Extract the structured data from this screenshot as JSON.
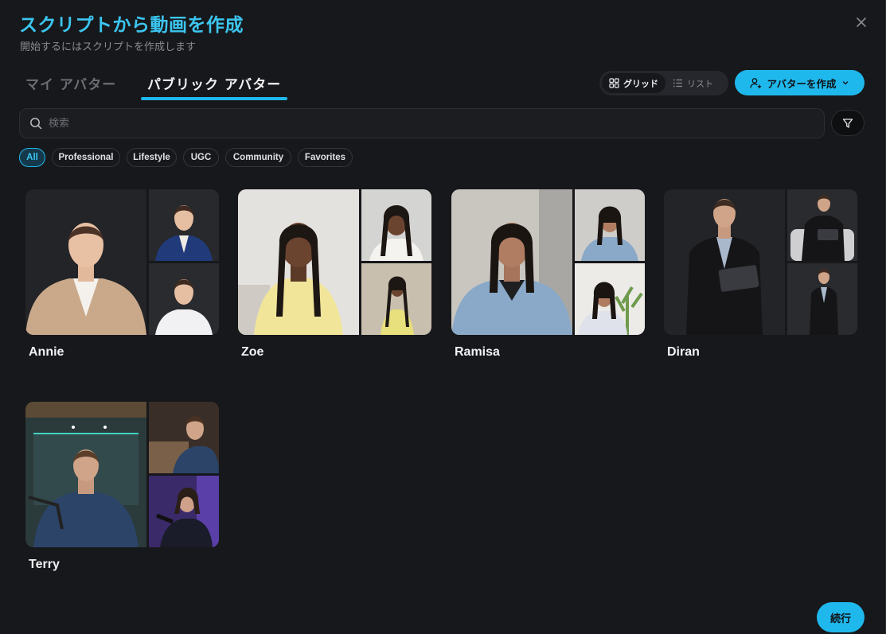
{
  "header": {
    "title": "スクリプトから動画を作成",
    "subtitle": "開始するにはスクリプトを作成します"
  },
  "tabs": [
    {
      "label": "マイ アバター",
      "active": false
    },
    {
      "label": "パブリック アバター",
      "active": true
    }
  ],
  "view_toggle": {
    "grid_label": "グリッド",
    "list_label": "リスト",
    "selected": "grid"
  },
  "create_button": {
    "label": "アバターを作成"
  },
  "search": {
    "placeholder": "検索",
    "value": ""
  },
  "filters": [
    {
      "label": "All",
      "selected": true
    },
    {
      "label": "Professional",
      "selected": false
    },
    {
      "label": "Lifestyle",
      "selected": false
    },
    {
      "label": "UGC",
      "selected": false
    },
    {
      "label": "Community",
      "selected": false
    },
    {
      "label": "Favorites",
      "selected": false
    }
  ],
  "avatars": [
    {
      "name": "Annie"
    },
    {
      "name": "Zoe"
    },
    {
      "name": "Ramisa"
    },
    {
      "name": "Diran"
    },
    {
      "name": "Terry"
    }
  ],
  "footer": {
    "continue_label": "続行"
  },
  "colors": {
    "accent": "#1fb8ec",
    "title": "#3bc6f0",
    "background": "#17181b"
  }
}
